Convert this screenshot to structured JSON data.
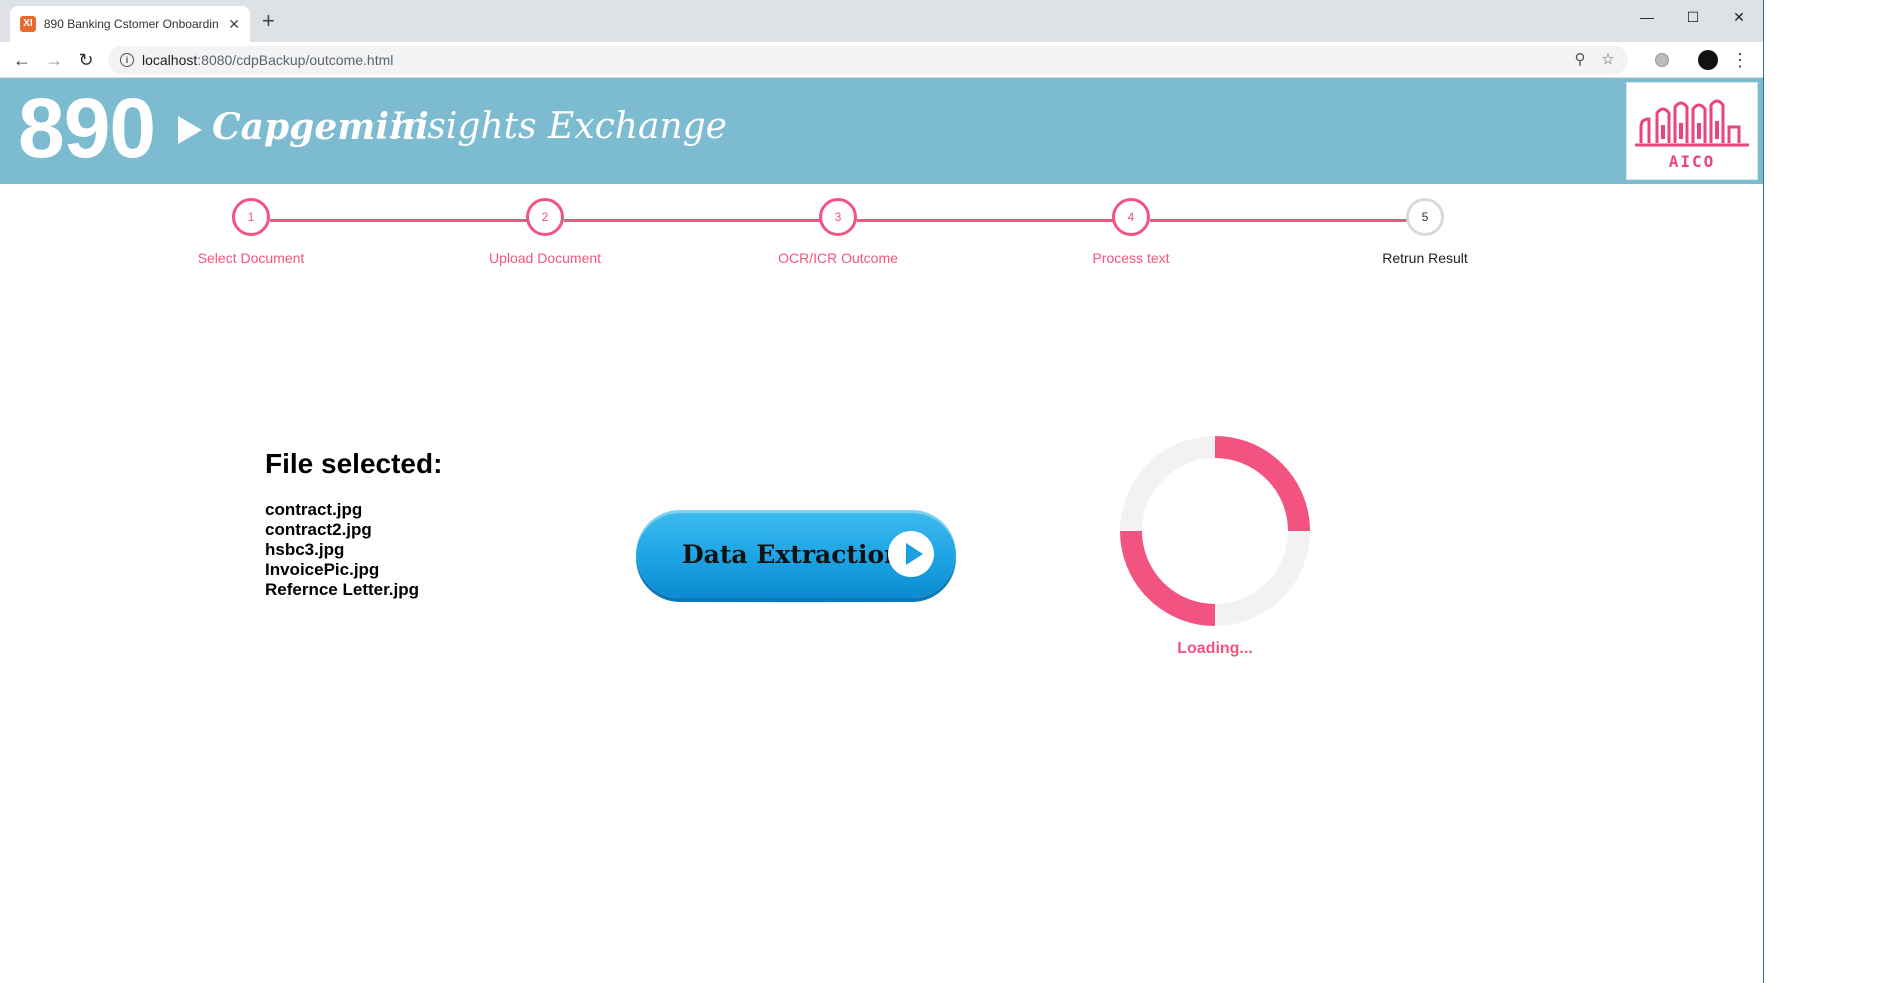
{
  "browser": {
    "tab_title": "890 Banking Cstomer Onboardin",
    "tab_favicon_text": "XI",
    "url_host": "localhost",
    "url_path": ":8080/cdpBackup/outcome.html",
    "window_controls": {
      "minimize": "—",
      "maximize": "☐",
      "close": "✕"
    },
    "icons": [
      "back-arrow-icon",
      "forward-arrow-icon",
      "reload-icon",
      "info-icon",
      "zoom-icon",
      "star-icon",
      "extension-icon",
      "profile-avatar",
      "menu-icon"
    ]
  },
  "header": {
    "brand_number": "890",
    "brand_company": "Capgemini",
    "brand_product": "Insights Exchange",
    "logo_text": "AICO",
    "colors": {
      "banner": "#7cbbd0",
      "accent": "#f25380"
    }
  },
  "stepper": {
    "steps": [
      {
        "number": "1",
        "label": "Select Document",
        "state": "complete"
      },
      {
        "number": "2",
        "label": "Upload Document",
        "state": "complete"
      },
      {
        "number": "3",
        "label": "OCR/ICR Outcome",
        "state": "complete"
      },
      {
        "number": "4",
        "label": "Process text",
        "state": "complete"
      },
      {
        "number": "5",
        "label": "Retrun Result",
        "state": "pending"
      }
    ]
  },
  "files": {
    "title": "File selected:",
    "items": [
      "contract.jpg",
      "contract2.jpg",
      "hsbc3.jpg",
      "InvoicePic.jpg",
      "Refernce Letter.jpg"
    ]
  },
  "action": {
    "label": "Data Extraction",
    "icon": "play-icon",
    "color": "#1ca3e4"
  },
  "loader": {
    "text": "Loading...",
    "track_color": "#f2f2f2",
    "arc_color": "#f25380"
  }
}
